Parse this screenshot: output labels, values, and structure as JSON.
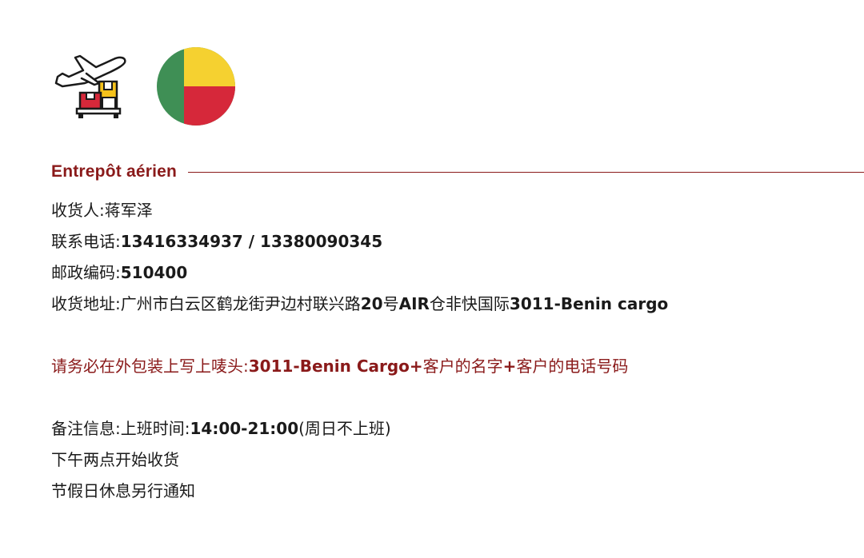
{
  "colors": {
    "accent": "#8a1a1a",
    "text": "#1a1a1a",
    "flag_green": "#3f8f55",
    "flag_yellow": "#f5d130",
    "flag_red": "#d6283a"
  },
  "icons": {
    "cargo": "airplane-cargo-boxes-icon",
    "flag": "benin-flag-icon"
  },
  "section": {
    "title": "Entrepôt aérien"
  },
  "address": {
    "recipient_label": "收货人:",
    "recipient_value": "蒋军泽",
    "phone_label": "联系电话:",
    "phone_value": "13416334937 / 13380090345",
    "postcode_label": "邮政编码:",
    "postcode_value": "510400",
    "addr_label": "收货地址:",
    "addr_value_1": "广州市白云区鹤龙街尹边村联兴路",
    "addr_value_2": "20",
    "addr_value_3": "号",
    "addr_value_4": "AIR",
    "addr_value_5": "仓非快国际",
    "addr_value_6": "3011-Benin cargo"
  },
  "notice": {
    "text_1": "请务必在外包装上写上唛头:",
    "text_2": "3011-Benin Cargo+",
    "text_3": "客户的名字",
    "text_4": "+",
    "text_5": "客户的电话号码"
  },
  "remarks": {
    "label": "备注信息:",
    "hours_label": "上班时间:",
    "hours_value": "14:00-21:00",
    "hours_note": "(周日不上班)",
    "line_2": "下午两点开始收货",
    "line_3": "节假日休息另行通知"
  }
}
